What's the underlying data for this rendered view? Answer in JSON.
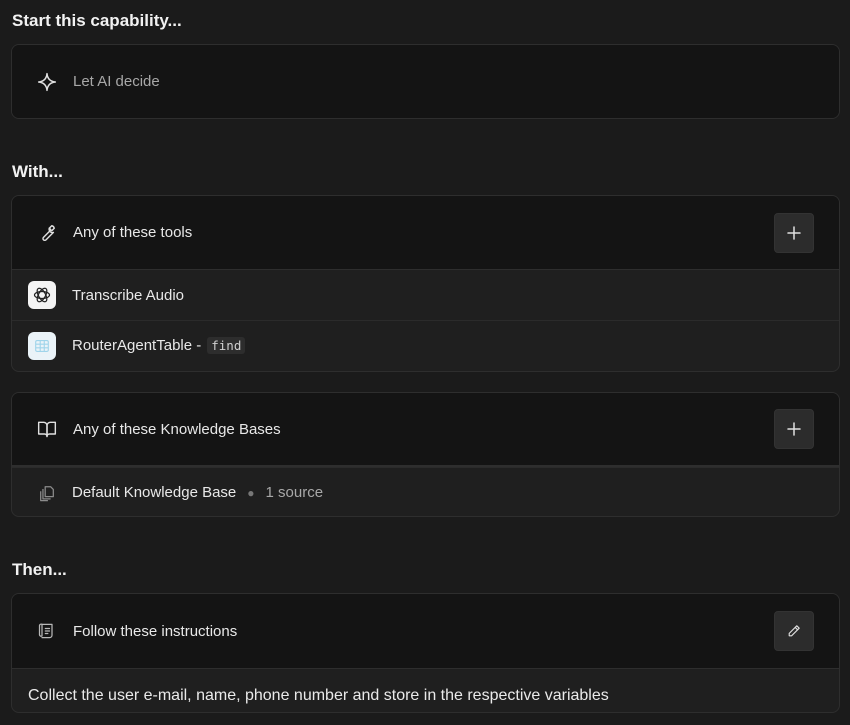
{
  "start_section": {
    "heading": "Start this capability...",
    "trigger_label": "Let AI decide"
  },
  "with_section": {
    "heading": "With...",
    "tools": {
      "header_label": "Any of these tools",
      "items": [
        {
          "label": "Transcribe Audio",
          "icon": "openai-icon"
        },
        {
          "label": "RouterAgentTable -",
          "icon": "table-icon",
          "code": "find"
        }
      ]
    },
    "knowledge_bases": {
      "header_label": "Any of these Knowledge Bases",
      "items": [
        {
          "label": "Default Knowledge Base",
          "count": "1 source",
          "icon": "documents-icon"
        }
      ]
    }
  },
  "then_section": {
    "heading": "Then...",
    "instructions_label": "Follow these instructions",
    "instructions_text": "Collect the user e-mail, name, phone number and store in the respective variables"
  }
}
